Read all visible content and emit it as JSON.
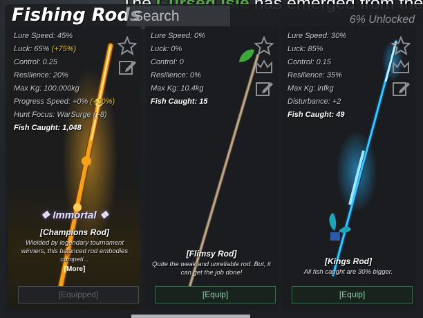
{
  "announcement": {
    "prefix": "The ",
    "highlight": "Cursed Isle",
    "suffix": " has emerged from the fo"
  },
  "header": {
    "title": "Fishing Rods",
    "search_placeholder": "Search",
    "unlocked": "6% Unlocked"
  },
  "colors": {
    "accent_green": "#5aa84a",
    "bonus_yellow": "#f0c419",
    "equip_green": "#8fd3a8"
  },
  "rods": [
    {
      "stats": {
        "lure_speed": "Lure Speed: 45%",
        "luck": "Luck: 65%",
        "luck_bonus": "(+75%)",
        "control": "Control: 0.25",
        "resilience": "Resilience: 20%",
        "max_kg": "Max Kg: 100,000kg",
        "progress_speed": "Progress Speed: +0%",
        "progress_bonus": "(+30%)",
        "hunt_focus": "Hunt Focus: WarSurge (+8)",
        "fish_caught": "Fish Caught: 1,048"
      },
      "rarity": "❖ Immortal ❖",
      "name": "[Champions Rod]",
      "description": "Wielded by legendary tournament winners, this balanced rod embodies competi...",
      "more": "[More]",
      "button": "[Equipped]",
      "icons": [
        "star-icon",
        "edit-icon"
      ]
    },
    {
      "stats": {
        "lure_speed": "Lure Speed: 0%",
        "luck": "Luck: 0%",
        "control": "Control: 0",
        "resilience": "Resilience: 0%",
        "max_kg": "Max Kg: 10.4kg",
        "fish_caught": "Fish Caught: 15"
      },
      "name": "[Flimsy Rod]",
      "description": "Quite the weak and unreliable rod. But, it can get the job done!",
      "button": "[Equip]",
      "icons": [
        "star-icon",
        "crown-icon",
        "edit-icon"
      ]
    },
    {
      "stats": {
        "lure_speed": "Lure Speed: 30%",
        "luck": "Luck: 85%",
        "control": "Control: 0.15",
        "resilience": "Resilience: 35%",
        "max_kg": "Max Kg: infkg",
        "disturbance": "Disturbance: +2",
        "fish_caught": "Fish Caught: 49"
      },
      "name": "[Kings Rod]",
      "description": "All fish caught are 30% bigger.",
      "button": "[Equip]",
      "icons": [
        "star-icon",
        "crown-icon",
        "edit-icon"
      ]
    }
  ]
}
